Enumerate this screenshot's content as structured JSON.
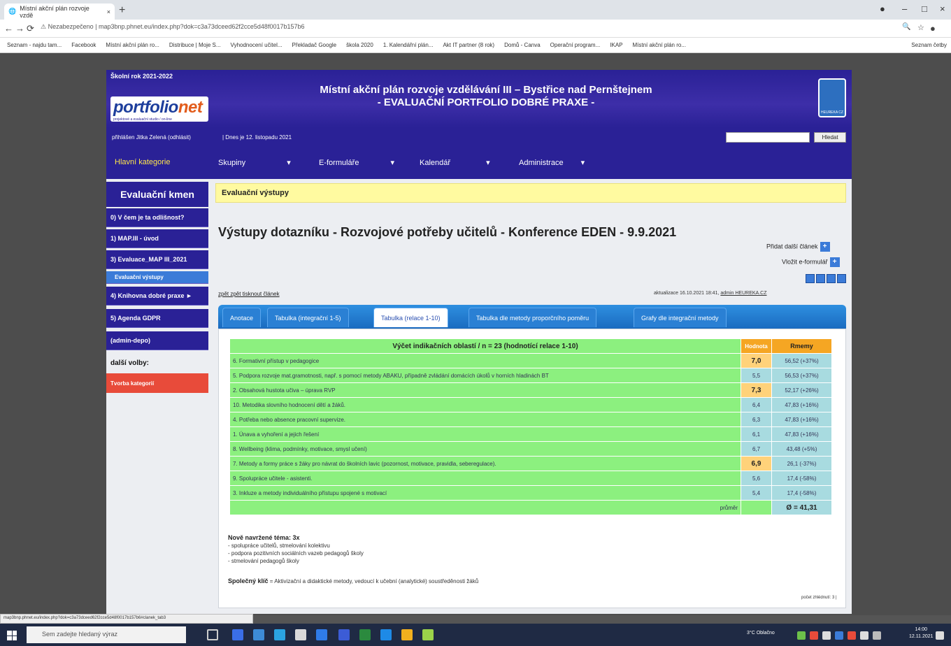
{
  "browser": {
    "tab_title": "Místní akční plán rozvoje vzdě",
    "url_prefix": "Nezabezpečeno",
    "url": "map3bnp.phnet.eu/index.php?dok=c3a73dceed62f2cce5d48f0017b157b6",
    "bookmarks": [
      "Seznam - najdu tam...",
      "Facebook",
      "Místní akční plán ro...",
      "Distribuce | Moje S...",
      "Vyhodnocení učitel...",
      "Překladač Google",
      "škola 2020",
      "1. Kalendářní plán...",
      "Akt IT partner (8 rok)",
      "Domů - Canva",
      "Operační program...",
      "IKAP",
      "Místní akční plán ro..."
    ],
    "bookmark_right": "Seznam četby"
  },
  "site": {
    "school_year": "Školní rok 2021-2022",
    "logo_main": "portfolio",
    "logo_accent": "net",
    "logo_sub": "projektové a evaluační studio / on-line",
    "title_line1": "Místní akční plán rozvoje vzdělávání III – Bystřice nad Pernštejnem",
    "title_line2": "- EVALUAČNÍ PORTFOLIO DOBRÉ PRAXE -",
    "emblem_label": "HEUREKA CZ",
    "user_info": "přihlášen Jitka Zelená (odhlásit)",
    "date_info": "| Dnes je 12. listopadu 2021",
    "search_button": "Hledat",
    "menu": [
      "Hlavní kategorie",
      "Skupiny",
      "E-formuláře",
      "Kalendář",
      "Administrace"
    ]
  },
  "sidebar": {
    "header": "Evaluační kmen",
    "items": [
      "0) V čem je ta odlišnost?",
      "1) MAP.III - úvod",
      "3) Evaluace_MAP III_2021",
      "Evaluační výstupy",
      "4) Knihovna dobré praxe ►",
      "5) Agenda GDPR",
      "(admin-depo)"
    ],
    "more": "další volby:",
    "create": "Tvorba kategorií"
  },
  "main": {
    "breadcrumb": "Evaluační výstupy",
    "title": "Výstupy dotazníku - Rozvojové potřeby učitelů - Konference EDEN - 9.9.2021",
    "add_member": "Přidat další článek",
    "view_form": "Vložit e-formulář",
    "links": "zpět zpět   tisknout článek",
    "updated": "aktualizace 16.10.2021 18:41,",
    "updated_by": "admin HEUREKA.CZ",
    "tabs": [
      "Anotace",
      "Tabulka (integrační 1-5)",
      "Tabulka (relace 1-10)",
      "Tabulka dle metody proporčního poměru",
      "Grafy dle integrační metody"
    ],
    "table": {
      "header": "Výčet indikačních oblastí / n = 23 (hodnotící relace 1-10)",
      "col_value": "Hodnota",
      "col_rank": "Rmemy",
      "rows": [
        {
          "label": "6. Formativní přístup v pedagogice",
          "value": "7,0",
          "rank": "56,52 (+37%)",
          "hi": true
        },
        {
          "label": "5. Podpora rozvoje mat.gramotnosti, např. s pomocí metody ABAKU, případně zvládání domácích úkolů v horních hladinách BT",
          "value": "5,5",
          "rank": "56,53 (+37%)",
          "hi": false
        },
        {
          "label": "2. Obsahová hustota učiva – úprava RVP",
          "value": "7,3",
          "rank": "52,17 (+26%)",
          "hi": true
        },
        {
          "label": "10. Metodika slovního hodnocení dětí a žáků.",
          "value": "6,4",
          "rank": "47,83 (+16%)",
          "hi": false
        },
        {
          "label": "4. Potřeba nebo absence pracovní supervize.",
          "value": "6,3",
          "rank": "47,83 (+16%)",
          "hi": false
        },
        {
          "label": "1. Únava a vyhoření a jejich řešení",
          "value": "6,1",
          "rank": "47,83 (+16%)",
          "hi": false
        },
        {
          "label": "8. Wellbeing (klima, podmínky, motivace, smysl učení)",
          "value": "6,7",
          "rank": "43,48 (+5%)",
          "hi": false
        },
        {
          "label": "7. Metody a formy práce s žáky pro návrat do školních lavic (pozornost, motivace, pravidla, seberegulace).",
          "value": "6,9",
          "rank": "26,1 (-37%)",
          "hi": true
        },
        {
          "label": "9. Spolupráce učitele - asistenti.",
          "value": "5,6",
          "rank": "17,4 (-58%)",
          "hi": false
        },
        {
          "label": "3. Inkluze a metody individuálního přístupu spojené s motivací",
          "value": "5,4",
          "rank": "17,4 (-58%)",
          "hi": false
        }
      ],
      "avg_label": "průměr",
      "avg_value": "Ø = 41,31"
    },
    "notes_title": "Nově navržené téma: 3x",
    "notes": [
      "- spolupráce učitelů, stmelování kolektivu",
      "- podpora pozitivních sociálních vazeb pedagogů školy",
      "- stmelování pedagogů školy"
    ],
    "key_label": "Společný klíč",
    "key_text": " = Aktivizační a didaktické metody, vedoucí k učební (analytické) soustředěnosti žáků",
    "views": "počet zhlédnutí: 3 |"
  },
  "status_url": "map3bnp.phnet.eu/index.php?dok=c3a73dceed62f2cce5d48f0017b157b6#clanek_tab3",
  "taskbar": {
    "search_placeholder": "Sem zadejte hledaný výraz",
    "weather": "3°C Oblačno",
    "time": "14:00",
    "date": "12.11.2021"
  }
}
